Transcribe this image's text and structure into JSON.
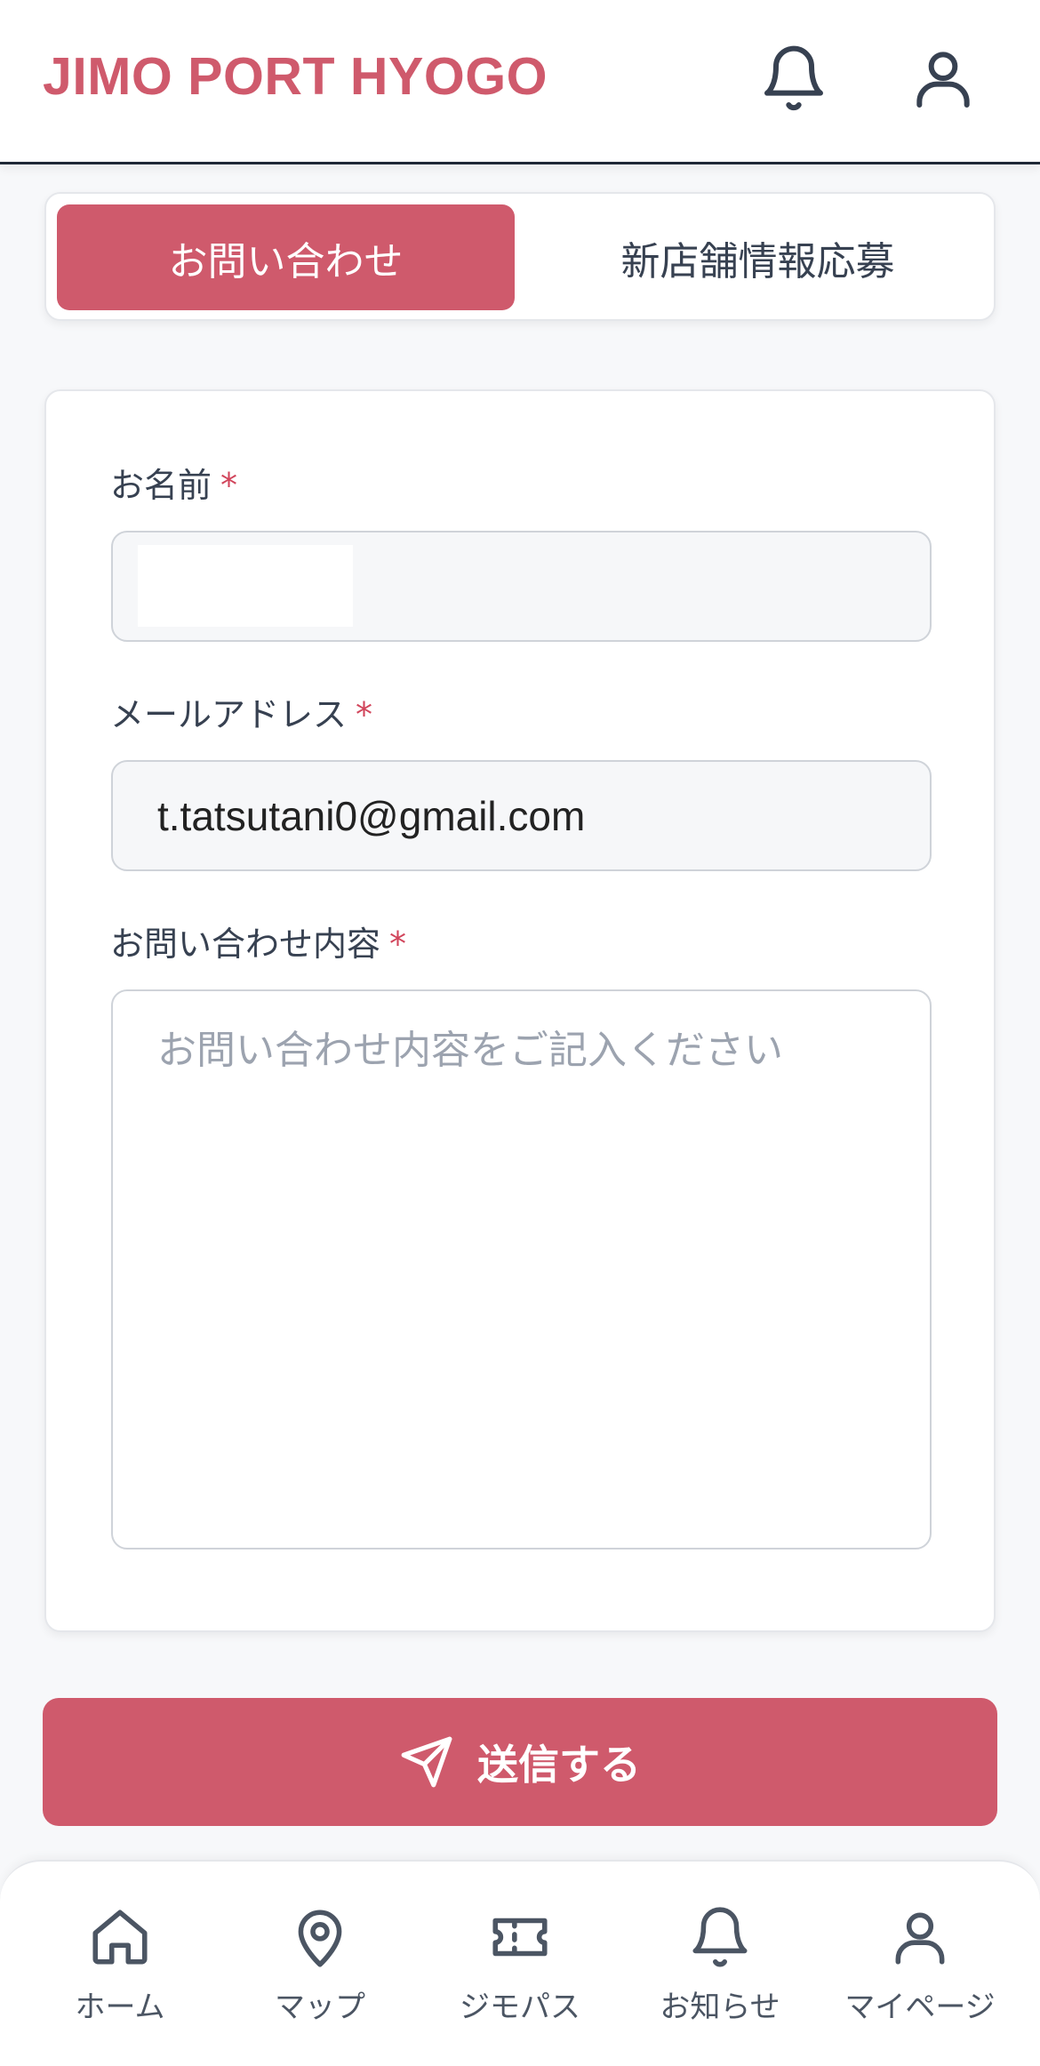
{
  "header": {
    "brand": "JIMO PORT HYOGO",
    "bell_icon": "bell-icon",
    "user_icon": "user-icon"
  },
  "tabs": [
    {
      "label": "お問い合わせ",
      "active": true
    },
    {
      "label": "新店舗情報応募",
      "active": false
    }
  ],
  "form": {
    "name_label": "お名前",
    "name_value": "",
    "email_label": "メールアドレス",
    "email_value": "t.tatsutani0@gmail.com",
    "message_label": "お問い合わせ内容",
    "message_placeholder": "お問い合わせ内容をご記入ください",
    "required_mark": "*"
  },
  "submit": {
    "label": "送信する",
    "icon": "send-icon"
  },
  "bottom_nav": [
    {
      "label": "ホーム",
      "icon": "home-icon"
    },
    {
      "label": "マップ",
      "icon": "map-pin-icon"
    },
    {
      "label": "ジモパス",
      "icon": "ticket-icon"
    },
    {
      "label": "お知らせ",
      "icon": "bell-icon"
    },
    {
      "label": "マイページ",
      "icon": "user-icon"
    }
  ],
  "colors": {
    "accent": "#cf5a6c",
    "required": "#d1455b",
    "text": "#374151",
    "placeholder": "#9ca3af",
    "background": "#f7f8fa"
  }
}
